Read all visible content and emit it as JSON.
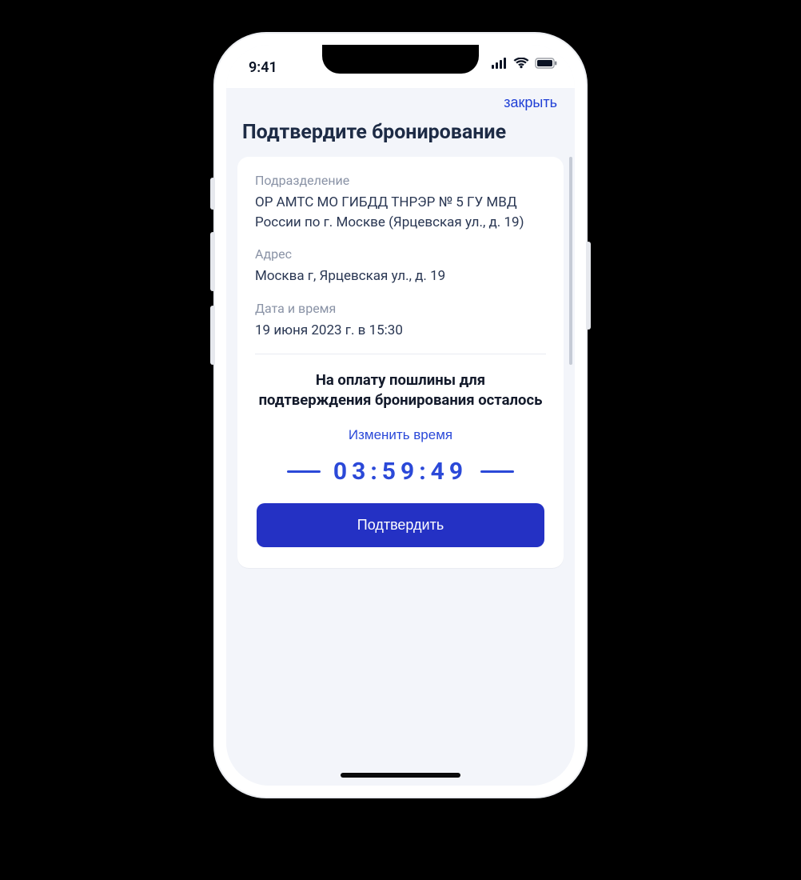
{
  "status": {
    "time": "9:41",
    "icons": {
      "cellular": "cellular-icon",
      "wifi": "wifi-icon",
      "battery": "battery-icon"
    }
  },
  "header": {
    "close_label": "закрыть",
    "title": "Подтвердите бронирование"
  },
  "details": {
    "department": {
      "label": "Подразделение",
      "value": "ОР АМТС МО ГИБДД ТНРЭР № 5 ГУ МВД России по г. Москве (Ярцевская ул., д. 19)"
    },
    "address": {
      "label": "Адрес",
      "value": "Москва г, Ярцевская ул., д. 19"
    },
    "datetime": {
      "label": "Дата и время",
      "value": "19 июня 2023 г. в 15:30"
    }
  },
  "notice": "На оплату пошлины для подтверждения бронирования осталось",
  "change_time_label": "Изменить время",
  "countdown": "03:59:49",
  "confirm_label": "Подтвердить",
  "colors": {
    "accent": "#2b49d8",
    "primary_button": "#2431c4",
    "text_primary": "#1d2b45",
    "text_muted": "#8a93a6"
  }
}
